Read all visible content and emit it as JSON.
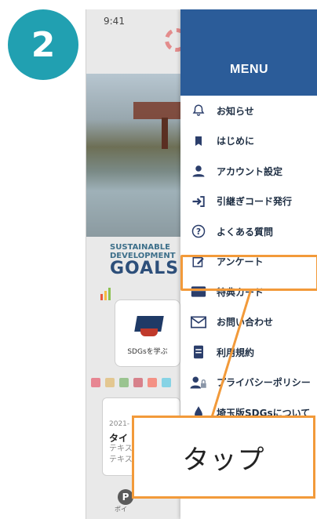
{
  "step": {
    "number": "2"
  },
  "status_bar": {
    "time": "9:41"
  },
  "background_app": {
    "sdg_heading": "SUSTAINABLE\nDEVELOPMENT",
    "goals_wordmark": "GOALS",
    "sdg_card_label": "SDGsを学ぶ",
    "news": {
      "date": "2021-",
      "title": "タイ",
      "body_line1": "テキス",
      "body_line2": "テキス"
    },
    "points_icon_letter": "P",
    "points_label": "ポイ"
  },
  "menu": {
    "title": "MENU",
    "header_color": "#2b5c99",
    "items": [
      {
        "label": "お知らせ",
        "icon": "bell-icon"
      },
      {
        "label": "はじめに",
        "icon": "bookmark-icon"
      },
      {
        "label": "アカウント設定",
        "icon": "user-icon"
      },
      {
        "label": "引継ぎコード発行",
        "icon": "sign-in-icon"
      },
      {
        "label": "よくある質問",
        "icon": "question-icon"
      },
      {
        "label": "アンケート",
        "icon": "edit-icon"
      },
      {
        "label": "特典カード",
        "icon": "card-icon"
      },
      {
        "label": "お問い合わせ",
        "icon": "mail-icon"
      },
      {
        "label": "利用規約",
        "icon": "document-icon"
      },
      {
        "label": "プライバシーポリシー",
        "icon": "user-lock-icon"
      },
      {
        "label": "埼玉版SDGsについて",
        "icon": "drop-icon"
      }
    ]
  },
  "callout": {
    "text": "タップ",
    "accent": "#f29a3a"
  }
}
